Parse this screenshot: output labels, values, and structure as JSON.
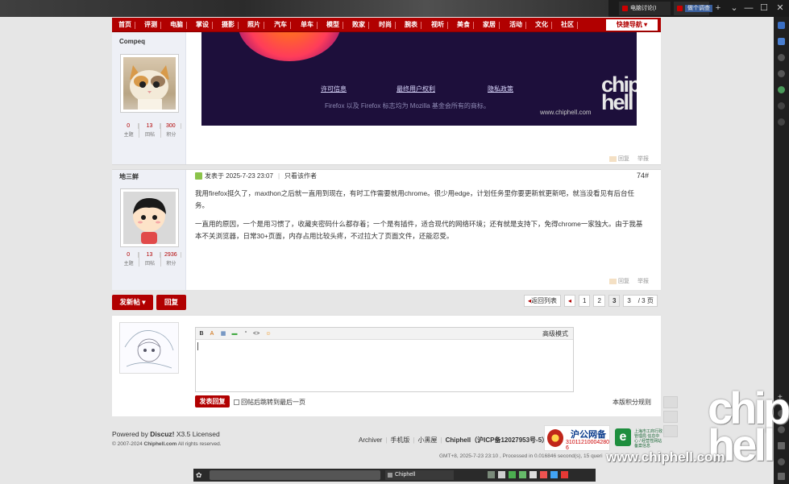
{
  "browser": {
    "tabs": [
      {
        "title": "电脑讨论(I"
      },
      {
        "title": "做个调查"
      }
    ],
    "window_controls": [
      "+",
      "⌄",
      "—",
      "☐",
      "✕"
    ]
  },
  "nav": {
    "items": [
      "首页",
      "评测",
      "电脑",
      "掌设",
      "摄影",
      "照片",
      "汽车",
      "单车",
      "模型",
      "败家",
      "时尚",
      "腕表",
      "视听",
      "美食",
      "家居",
      "活动",
      "文化",
      "社区"
    ],
    "quick": "快捷导航"
  },
  "posts": [
    {
      "author": "Compeq",
      "stats": [
        {
          "value": "0",
          "label": "主题"
        },
        {
          "value": "13",
          "label": "回帖"
        },
        {
          "value": "300",
          "label": "积分"
        }
      ],
      "image": {
        "links": [
          "许可信息",
          "最终用户权利",
          "隐私政策"
        ],
        "copyright": "Firefox 以及 Firefox 标志均为 Mozilla 基金会所有的商标。",
        "watermark_url": "www.chiphell.com",
        "watermark_logo": "chip hell"
      },
      "actions": [
        "回复",
        "举报"
      ]
    },
    {
      "author": "地三鲜",
      "stats": [
        {
          "value": "0",
          "label": "主题"
        },
        {
          "value": "13",
          "label": "回帖"
        },
        {
          "value": "2936",
          "label": "积分"
        }
      ],
      "posted": "发表于 2025-7-23 23:07",
      "only_author": "只看该作者",
      "floor": "74#",
      "paragraphs": [
        "我用firefox挺久了，maxthon之后就一直用到现在，有时工作需要就用chrome。很少用edge，计划任务里你要更新就更新吧，就当没看见有后台任务。",
        "一直用的原因，一个是用习惯了，收藏夹密码什么都存着；一个是有插件，适合现代的网络环境；还有就是支持下，免得chrome一家独大。由于我基本不关浏览器，日常30+页面，内存占用比较头疼，不过拉大了页面文件，还能忍受。"
      ],
      "actions": [
        "回复",
        "举报"
      ]
    }
  ],
  "toolbar": {
    "new_post": "发新帖",
    "reply": "回复",
    "back_to_list": "返回列表",
    "pages": [
      "1",
      "2",
      "3"
    ],
    "current_page": "3",
    "page_input": "3",
    "page_total": "/ 3 页"
  },
  "reply_form": {
    "editor_tools": [
      "B",
      "A",
      "▦",
      "▬",
      "“",
      "<>",
      "☺"
    ],
    "advanced_mode": "高级模式",
    "submit": "发表回复",
    "jump_label": "回帖后跳转到最后一页",
    "rules": "本版积分规则"
  },
  "footer": {
    "powered_prefix": "Powered by ",
    "powered_name": "Discuz!",
    "powered_suffix": " X3.5 Licensed",
    "copyright_prefix": "© 2007-2024 ",
    "copyright_site": "Chiphell.com",
    "copyright_suffix": " All rights reserved.",
    "links": [
      "Archiver",
      "手机版",
      "小黑屋",
      "Chiphell（沪ICP备12027953号-5）"
    ],
    "gmt": "GMT+8, 2025-7-23 23:10 , Processed in 0.016846 second(s), 15 queri",
    "police_title": "沪公网备",
    "police_number": "31011210004280​6",
    "ebadge_text": "上海市工商行政管理局 信息中心 / 经营性网站备案信息"
  },
  "watermark": {
    "logo": "chip hell",
    "url": "www.chiphell.com"
  },
  "taskbar": {
    "task_title": "Chiphell"
  },
  "colors": {
    "brand_red": "#b10000",
    "page_bg": "#e6e6e6",
    "author_col_bg": "#eef0f6"
  }
}
